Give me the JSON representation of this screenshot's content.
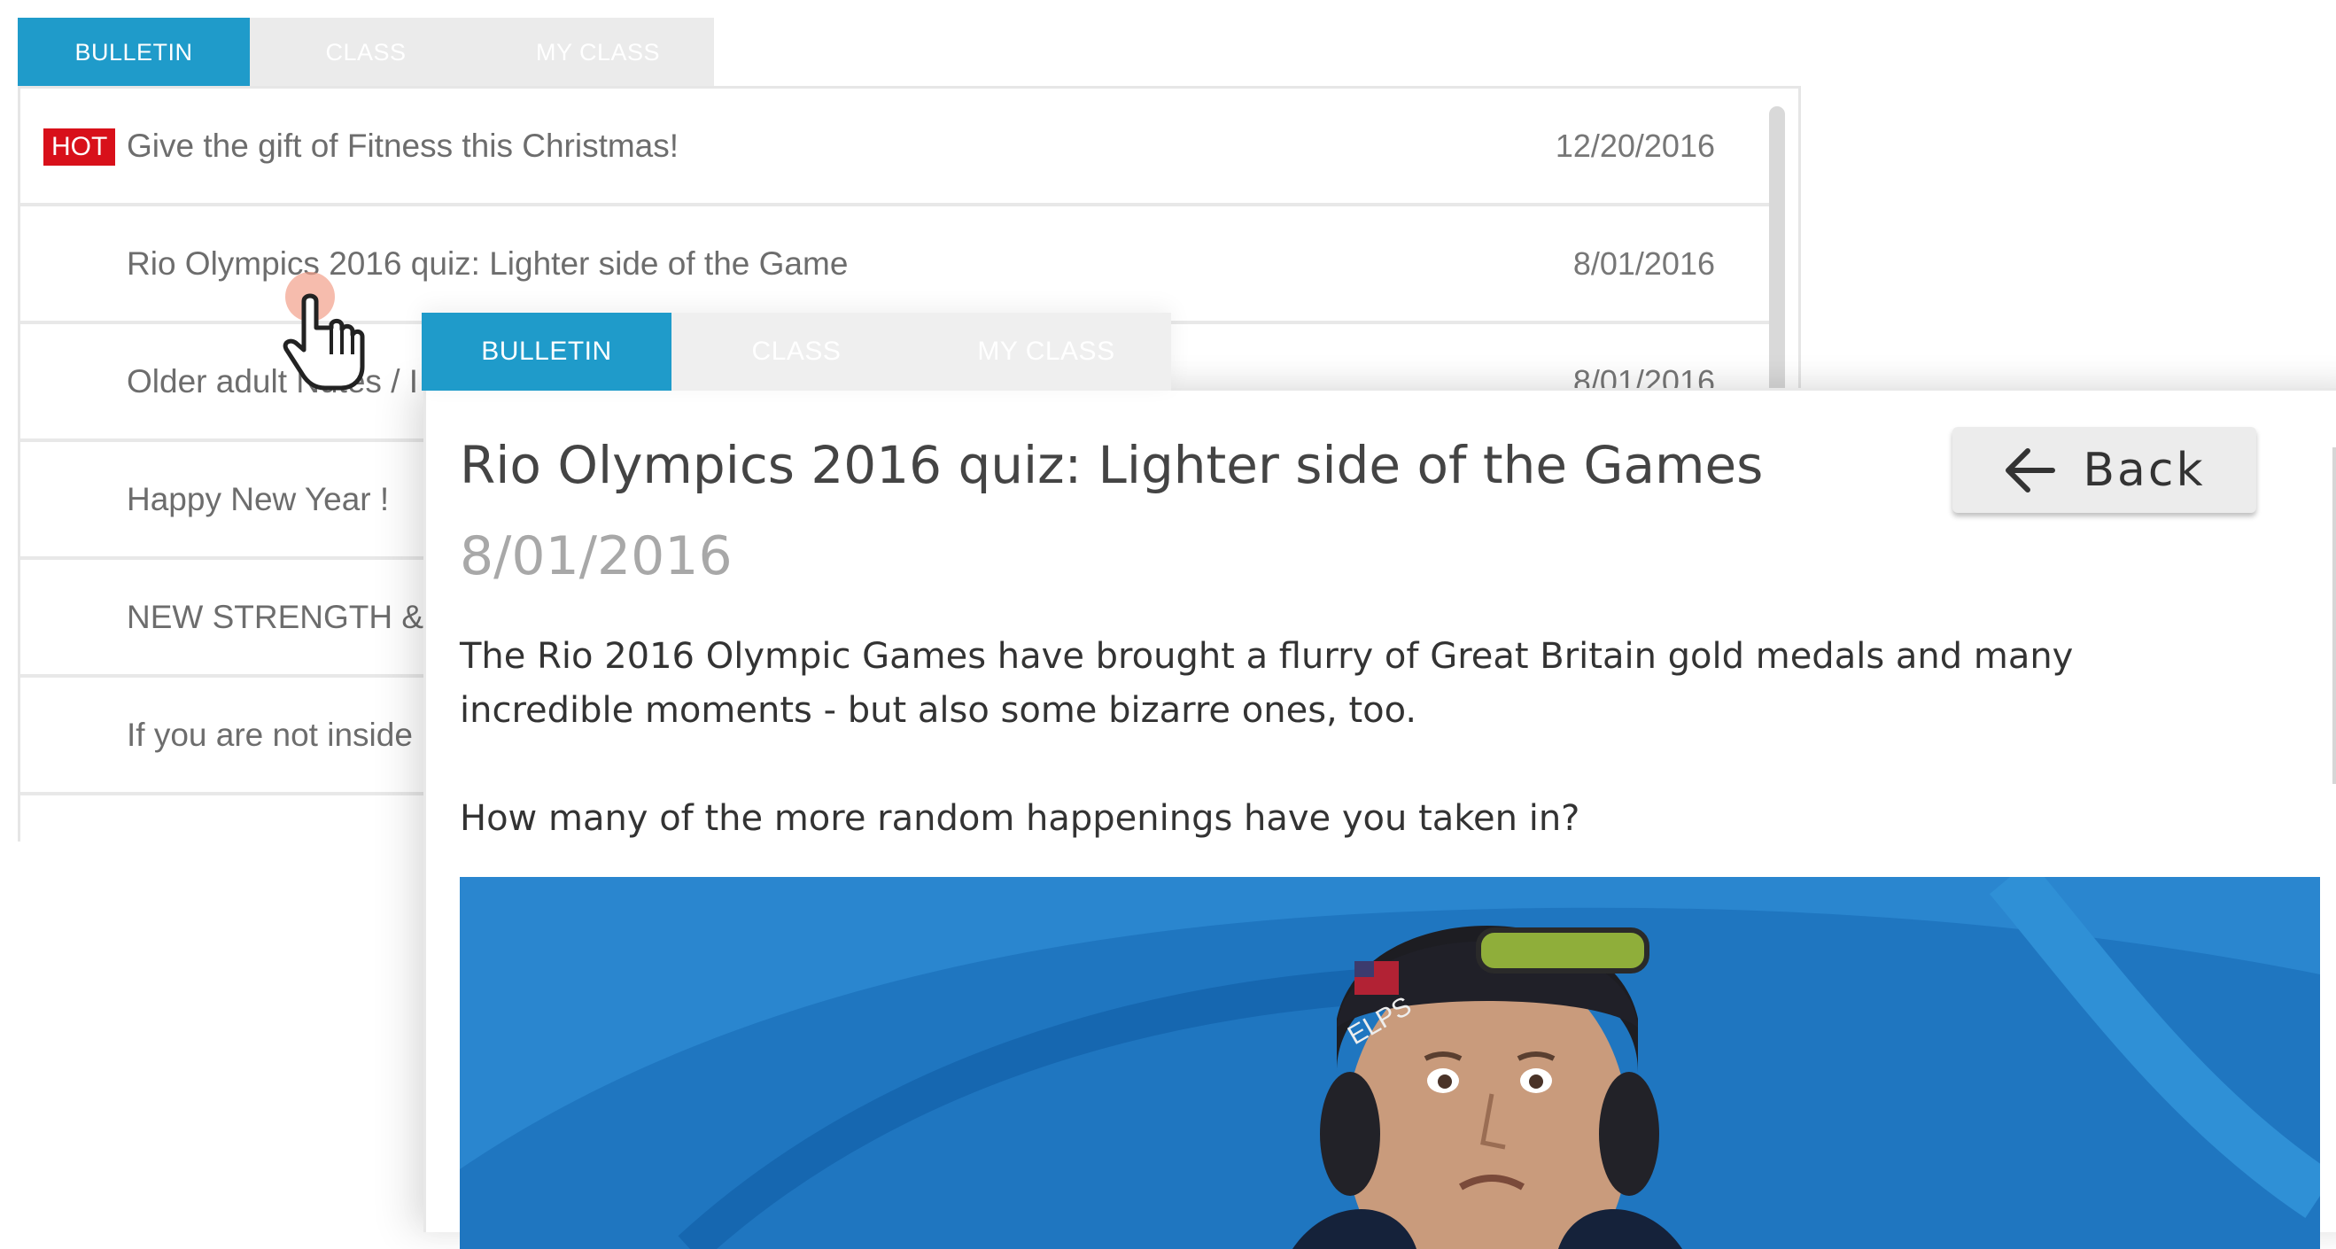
{
  "list_tabs": [
    {
      "label": "BULLETIN",
      "active": true
    },
    {
      "label": "CLASS",
      "active": false
    },
    {
      "label": "MY CLASS",
      "active": false
    }
  ],
  "bulletin_list": [
    {
      "hot": true,
      "hot_label": "HOT",
      "title": "Give the gift of Fitness this Christmas!",
      "date": "12/20/2016"
    },
    {
      "hot": false,
      "title": "Rio Olympics 2016 quiz: Lighter side of the Game",
      "date": "8/01/2016"
    },
    {
      "hot": false,
      "title": "Older adult Nutes / I",
      "date": "8/01/2016"
    },
    {
      "hot": false,
      "title": "Happy New Year !",
      "date": ""
    },
    {
      "hot": false,
      "title": "NEW STRENGTH & C",
      "date": ""
    },
    {
      "hot": false,
      "title": "If you are not inside",
      "date": ""
    }
  ],
  "detail_tabs": [
    {
      "label": "BULLETIN",
      "active": true
    },
    {
      "label": "CLASS",
      "active": false
    },
    {
      "label": "MY CLASS",
      "active": false
    }
  ],
  "article": {
    "title": "Rio Olympics 2016 quiz: Lighter side of the Games",
    "date": "8/01/2016",
    "back_label": "Back",
    "paragraph_1": "The Rio 2016 Olympic Games have brought a flurry of Great Britain gold medals and many incredible moments - but also some bizarre ones, too.",
    "paragraph_2": "How many of the more random happenings have you taken in?",
    "photo_cap_text": "ELPS"
  },
  "colors": {
    "accent": "#1f9bca",
    "hot": "#d8101a",
    "photo_bg": "#1f76c0"
  },
  "icons": {
    "back": "arrow-left-icon",
    "cursor": "hand-pointer-icon"
  }
}
